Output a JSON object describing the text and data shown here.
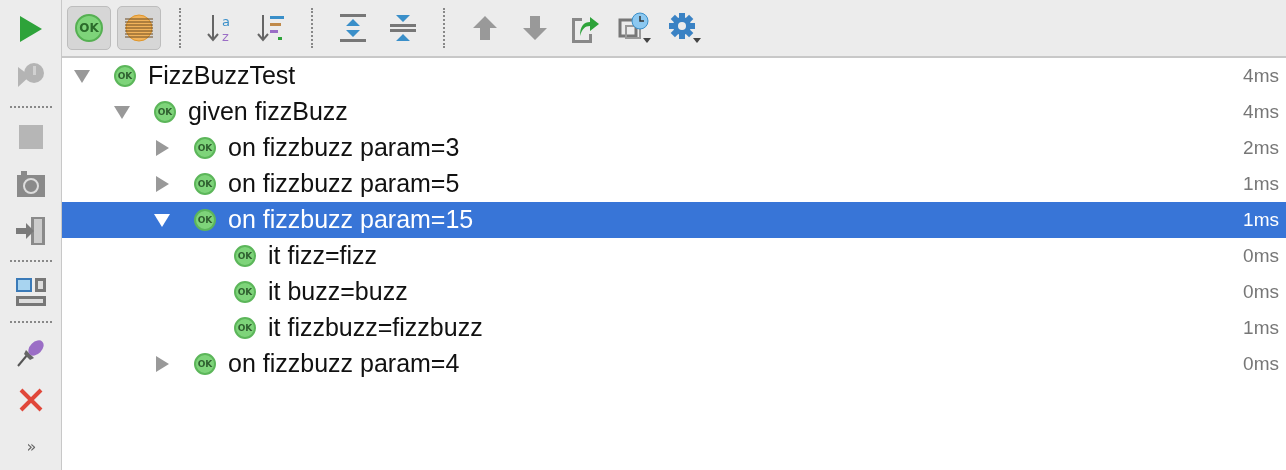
{
  "side_toolbar": [
    {
      "kind": "run",
      "disabled": false
    },
    {
      "kind": "rerun",
      "disabled": true
    },
    {
      "kind": "separator"
    },
    {
      "kind": "stop",
      "disabled": true
    },
    {
      "kind": "camera",
      "disabled": false
    },
    {
      "kind": "exit",
      "disabled": false
    },
    {
      "kind": "separator"
    },
    {
      "kind": "layout",
      "disabled": false
    },
    {
      "kind": "separator"
    },
    {
      "kind": "pin",
      "disabled": false
    },
    {
      "kind": "close",
      "disabled": false
    },
    {
      "kind": "more",
      "label": "»"
    }
  ],
  "top_toolbar": [
    {
      "kind": "show-passed",
      "label": "OK",
      "pressed": true
    },
    {
      "kind": "show-ignored",
      "pressed": true
    },
    {
      "kind": "separator"
    },
    {
      "kind": "sort-alpha",
      "letters": [
        "a",
        "z"
      ],
      "pressed": false
    },
    {
      "kind": "sort-duration",
      "pressed": false
    },
    {
      "kind": "separator"
    },
    {
      "kind": "expand-all",
      "pressed": false
    },
    {
      "kind": "collapse-all",
      "pressed": false
    },
    {
      "kind": "separator"
    },
    {
      "kind": "up",
      "pressed": false
    },
    {
      "kind": "down",
      "pressed": false
    },
    {
      "kind": "export",
      "pressed": false
    },
    {
      "kind": "history",
      "pressed": false
    },
    {
      "kind": "settings",
      "pressed": false
    }
  ],
  "tree": [
    {
      "label": "FizzBuzzTest",
      "status": "OK",
      "time": "4ms",
      "expanded": true,
      "selected": false,
      "children": [
        {
          "label": "given fizzBuzz",
          "status": "OK",
          "time": "4ms",
          "expanded": true,
          "selected": false,
          "children": [
            {
              "label": "on fizzbuzz param=3",
              "status": "OK",
              "time": "2ms",
              "expanded": false,
              "selected": false
            },
            {
              "label": "on fizzbuzz param=5",
              "status": "OK",
              "time": "1ms",
              "expanded": false,
              "selected": false
            },
            {
              "label": "on fizzbuzz param=15",
              "status": "OK",
              "time": "1ms",
              "expanded": true,
              "selected": true,
              "children": [
                {
                  "label": "it fizz=fizz",
                  "status": "OK",
                  "time": "0ms",
                  "selected": false
                },
                {
                  "label": "it buzz=buzz",
                  "status": "OK",
                  "time": "0ms",
                  "selected": false
                },
                {
                  "label": "it fizzbuzz=fizzbuzz",
                  "status": "OK",
                  "time": "1ms",
                  "selected": false
                }
              ]
            },
            {
              "label": "on fizzbuzz param=4",
              "status": "OK",
              "time": "0ms",
              "expanded": false,
              "selected": false
            }
          ]
        }
      ]
    }
  ]
}
